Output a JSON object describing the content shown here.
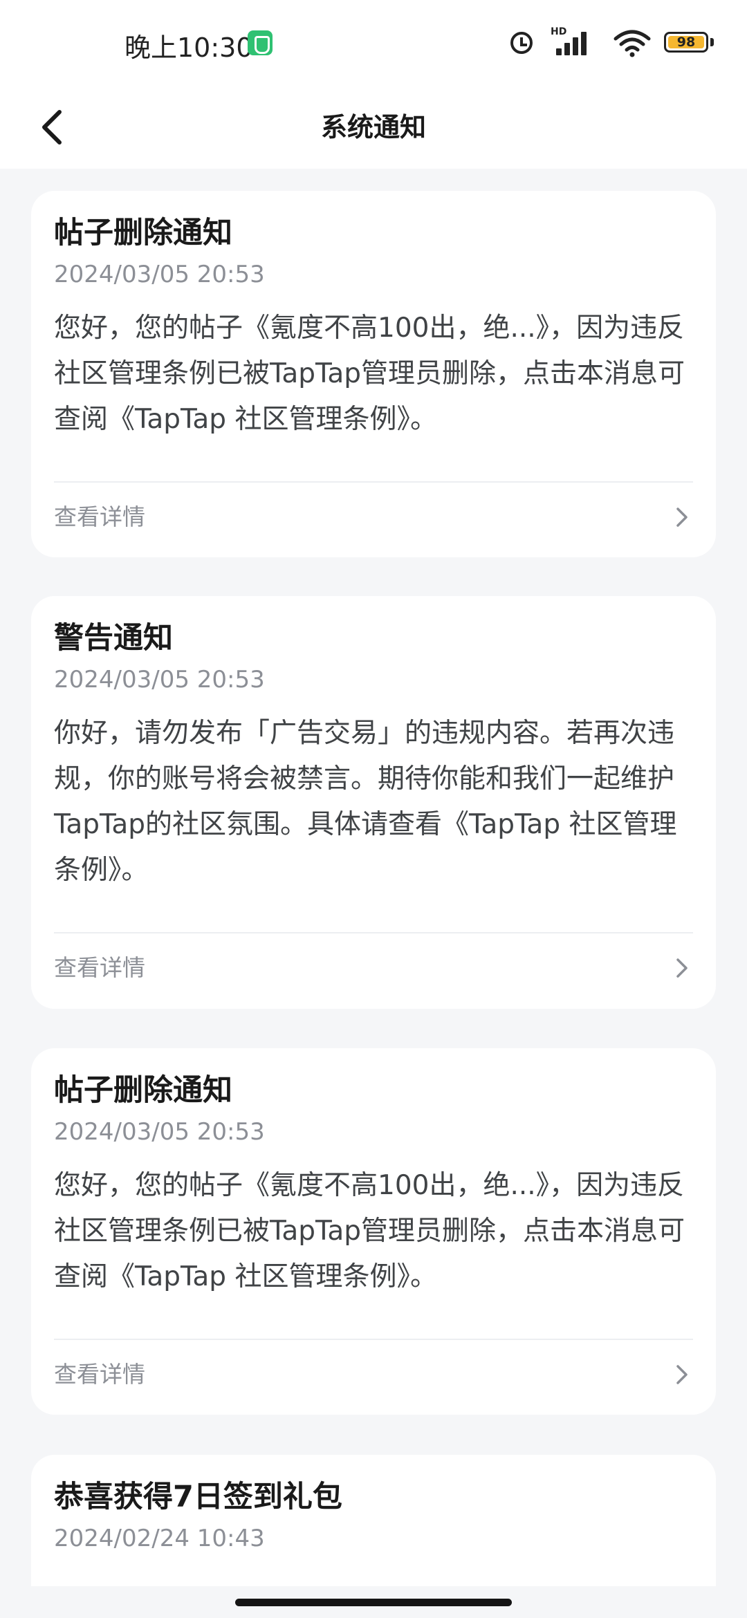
{
  "status_bar": {
    "time": "晚上10:30",
    "battery_level": "98",
    "network_badge": "HD",
    "colors": {
      "battery_fill": "#f5b731",
      "shield": "#2fc172"
    }
  },
  "header": {
    "title": "系统通知",
    "back_icon": "chevron-left-icon"
  },
  "notifications": [
    {
      "title": "帖子删除通知",
      "time": "2024/03/05 20:53",
      "body": "您好，您的帖子《氪度不高100出，绝...》，因为违反社区管理条例已被TapTap管理员删除，点击本消息可查阅《TapTap 社区管理条例》。",
      "link": "查看详情"
    },
    {
      "title": "警告通知",
      "time": "2024/03/05 20:53",
      "body": "你好，请勿发布「广告交易」的违规内容。若再次违规，你的账号将会被禁言。期待你能和我们一起维护TapTap的社区氛围。具体请查看《TapTap 社区管理条例》。",
      "link": "查看详情"
    },
    {
      "title": "帖子删除通知",
      "time": "2024/03/05 20:53",
      "body": "您好，您的帖子《氪度不高100出，绝...》，因为违反社区管理条例已被TapTap管理员删除，点击本消息可查阅《TapTap 社区管理条例》。",
      "link": "查看详情"
    },
    {
      "title": "恭喜获得7日签到礼包",
      "time": "2024/02/24 10:43"
    }
  ]
}
